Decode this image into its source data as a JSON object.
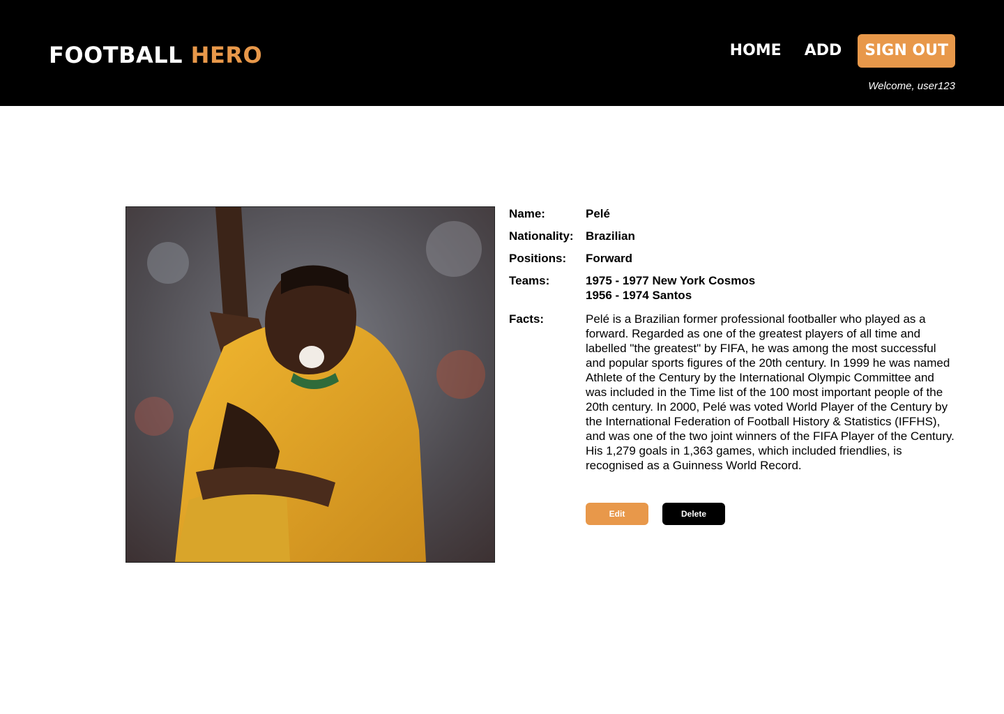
{
  "header": {
    "logo_main": "FOOTBALL",
    "logo_accent": "HERO",
    "nav": {
      "home": "HOME",
      "add": "ADD",
      "sign_out": "SIGN OUT"
    },
    "welcome": "Welcome, user123"
  },
  "colors": {
    "accent": "#e8984a",
    "header_bg": "#000000"
  },
  "player": {
    "photo_icon": "player-photo",
    "labels": {
      "name": "Name:",
      "nationality": "Nationality:",
      "positions": "Positions:",
      "teams": "Teams:",
      "facts": "Facts:"
    },
    "name": "Pelé",
    "nationality": "Brazilian",
    "positions": "Forward",
    "teams": [
      "1975 - 1977 New York Cosmos",
      "1956 - 1974 Santos"
    ],
    "facts": "Pelé is a Brazilian former professional footballer who played as a forward. Regarded as one of the greatest players of all time and labelled \"the greatest\" by FIFA, he was among the most successful and popular sports figures of the 20th century. In 1999 he was named Athlete of the Century by the International Olympic Committee and was included in the Time list of the 100 most important people of the 20th century. In 2000, Pelé was voted World Player of the Century by the International Federation of Football History & Statistics (IFFHS), and was one of the two joint winners of the FIFA Player of the Century. His 1,279 goals in 1,363 games, which included friendlies, is recognised as a Guinness World Record."
  },
  "actions": {
    "edit": "Edit",
    "delete": "Delete"
  }
}
